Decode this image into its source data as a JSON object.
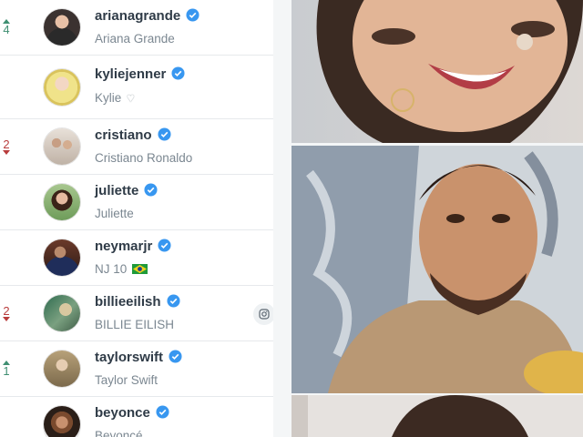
{
  "accounts": [
    {
      "rank_change": "4",
      "direction": "up",
      "username": "arianagrande",
      "display_name": "Ariana Grande",
      "extra": ""
    },
    {
      "rank_change": "",
      "direction": "none",
      "username": "kyliejenner",
      "display_name": "Kylie",
      "extra": "heart"
    },
    {
      "rank_change": "2",
      "direction": "down",
      "username": "cristiano",
      "display_name": "Cristiano Ronaldo",
      "extra": ""
    },
    {
      "rank_change": "",
      "direction": "none",
      "username": "juliette",
      "display_name": "Juliette",
      "extra": ""
    },
    {
      "rank_change": "",
      "direction": "none",
      "username": "neymarjr",
      "display_name": "NJ 10",
      "extra": "brazil-flag"
    },
    {
      "rank_change": "2",
      "direction": "down",
      "username": "billieeilish",
      "display_name": "BILLIE EILISH",
      "extra": "instagram-icon"
    },
    {
      "rank_change": "1",
      "direction": "up",
      "username": "taylorswift",
      "display_name": "Taylor Swift",
      "extra": ""
    },
    {
      "rank_change": "",
      "direction": "none",
      "username": "beyonce",
      "display_name": "Beyoncé",
      "extra": ""
    }
  ],
  "icons": {
    "verified": "verified-badge-icon",
    "heart": "white-heart-icon",
    "flag": "brazil-flag-icon",
    "instagram": "instagram-icon"
  },
  "colors": {
    "verified": "#3897f0",
    "up": "#3f8f72",
    "down": "#b93d3d",
    "username": "#2f3b47",
    "display_name": "#7b8791"
  }
}
